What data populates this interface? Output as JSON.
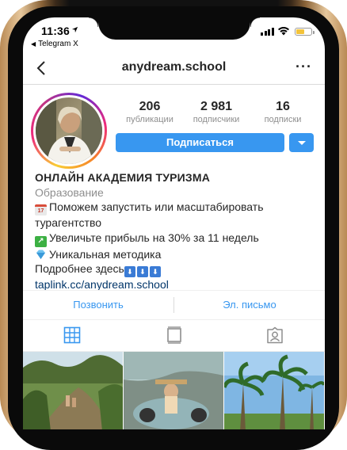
{
  "status_bar": {
    "time": "11:36",
    "back_app": "Telegram X",
    "battery_color": "#f3c33a"
  },
  "nav": {
    "username": "anydream.school",
    "back_icon": "chevron-left-icon",
    "more_label": "···"
  },
  "profile": {
    "stats": [
      {
        "value": "206",
        "label": "публикации"
      },
      {
        "value": "2 981",
        "label": "подписчики"
      },
      {
        "value": "16",
        "label": "подписки"
      }
    ],
    "follow_label": "Подписаться",
    "accent_color": "#3897f0"
  },
  "bio": {
    "name": "ОНЛАЙН АКАДЕМИЯ ТУРИЗМА",
    "category": "Образование",
    "line1": "Поможем запустить или масштабировать турагентство",
    "line2": "Увеличьте прибыль на 30% за 11 недель",
    "line3": "Уникальная методика",
    "line4": "Подробнее здесь",
    "link": "taplink.cc/anydream.school"
  },
  "actions": {
    "call": "Позвонить",
    "email": "Эл. письмо"
  },
  "tabs": [
    {
      "icon": "grid-icon",
      "active": true
    },
    {
      "icon": "feed-icon",
      "active": false
    },
    {
      "icon": "tagged-icon",
      "active": false
    }
  ]
}
